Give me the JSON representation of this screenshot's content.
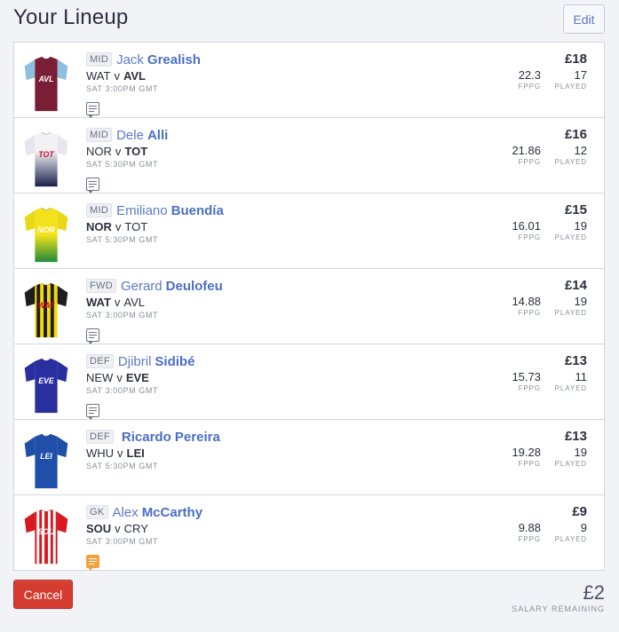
{
  "header": {
    "title": "Your Lineup",
    "edit_label": "Edit"
  },
  "players": [
    {
      "pos": "MID",
      "first": "Jack",
      "last": "Grealish",
      "home": "WAT",
      "away": "AVL",
      "bold": "away",
      "kick": "SAT 3:00PM GMT",
      "price": "£18",
      "fppg": "22.3",
      "played": "17",
      "note": "default",
      "kit": {
        "abbr": "AVL",
        "body": "#7a1e35",
        "sleeve": "#8fbfe0",
        "pattern": "plain",
        "text": "#ffffff"
      }
    },
    {
      "pos": "MID",
      "first": "Dele",
      "last": "Alli",
      "home": "NOR",
      "away": "TOT",
      "bold": "away",
      "kick": "SAT 5:30PM GMT",
      "price": "£16",
      "fppg": "21.86",
      "played": "12",
      "note": "default",
      "kit": {
        "abbr": "TOT",
        "body": "#f2f2f5",
        "sleeve": "#e6e6ec",
        "pattern": "fade-navy",
        "text": "#c8102e"
      }
    },
    {
      "pos": "MID",
      "first": "Emiliano",
      "last": "Buendía",
      "home": "NOR",
      "away": "TOT",
      "bold": "home",
      "kick": "SAT 5:30PM GMT",
      "price": "£15",
      "fppg": "16.01",
      "played": "19",
      "note": "none",
      "kit": {
        "abbr": "NOR",
        "body": "#f3e21b",
        "sleeve": "#e8d815",
        "pattern": "fade-green",
        "text": "#ffffff"
      }
    },
    {
      "pos": "FWD",
      "first": "Gerard",
      "last": "Deulofeu",
      "home": "WAT",
      "away": "AVL",
      "bold": "home",
      "kick": "SAT 3:00PM GMT",
      "price": "£14",
      "fppg": "14.88",
      "played": "19",
      "note": "default",
      "kit": {
        "abbr": "WAT",
        "body": "#f5d90a",
        "sleeve": "#1d1d1d",
        "pattern": "stripes-black",
        "text": "#c8102e"
      }
    },
    {
      "pos": "DEF",
      "first": "Djibril",
      "last": "Sidibé",
      "home": "NEW",
      "away": "EVE",
      "bold": "away",
      "kick": "SAT 3:00PM GMT",
      "price": "£13",
      "fppg": "15.73",
      "played": "11",
      "note": "default",
      "kit": {
        "abbr": "EVE",
        "body": "#2a2fa0",
        "sleeve": "#2a2fa0",
        "pattern": "plain",
        "text": "#ffffff"
      }
    },
    {
      "pos": "DEF",
      "first": "",
      "last": "Ricardo Pereira",
      "home": "WHU",
      "away": "LEI",
      "bold": "away",
      "kick": "SAT 5:30PM GMT",
      "price": "£13",
      "fppg": "19.28",
      "played": "19",
      "note": "none",
      "kit": {
        "abbr": "LEI",
        "body": "#1f4fa8",
        "sleeve": "#1f4fa8",
        "pattern": "plain",
        "text": "#ffffff"
      }
    },
    {
      "pos": "GK",
      "first": "Alex",
      "last": "McCarthy",
      "home": "SOU",
      "away": "CRY",
      "bold": "home",
      "kick": "SAT 3:00PM GMT",
      "price": "£9",
      "fppg": "9.88",
      "played": "9",
      "note": "orange",
      "kit": {
        "abbr": "SOU",
        "body": "#d71920",
        "sleeve": "#d71920",
        "pattern": "stripes-white",
        "text": "#ffffff"
      }
    }
  ],
  "labels": {
    "fppg": "FPPG",
    "played": "PLAYED",
    "versus": "v"
  },
  "footer": {
    "cancel_label": "Cancel",
    "salary_amount": "£2",
    "salary_label": "SALARY REMAINING"
  }
}
